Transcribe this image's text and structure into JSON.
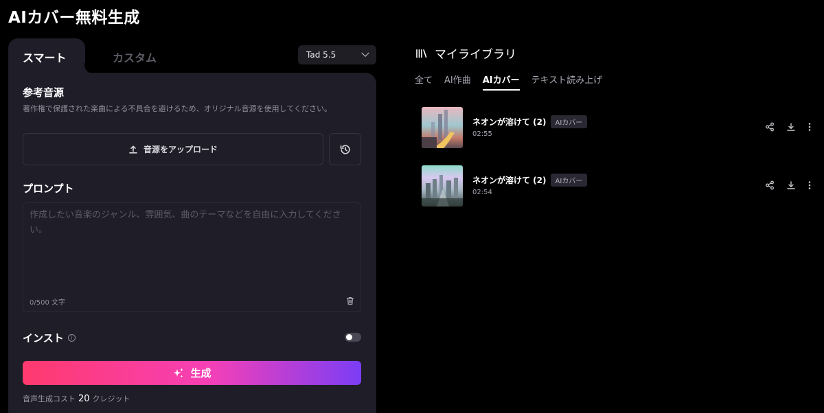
{
  "page": {
    "title": "AIカバー無料生成"
  },
  "left": {
    "tabs": [
      {
        "label": "スマート"
      },
      {
        "label": "カスタム"
      }
    ],
    "model": "Tad 5.5",
    "reference": {
      "title": "参考音源",
      "description": "著作権で保護された楽曲による不具合を避けるため、オリジナル音源を使用してください。",
      "upload_label": "音源をアップロード"
    },
    "prompt": {
      "title": "プロンプト",
      "placeholder": "作成したい音楽のジャンル、雰囲気、曲のテーマなどを自由に入力してください。",
      "count": "0/500 文字"
    },
    "instrumental": {
      "label": "インスト",
      "enabled": false
    },
    "generate_label": "生成",
    "cost": {
      "prefix": "音声生成コスト",
      "amount": "20",
      "suffix": "クレジット"
    }
  },
  "library": {
    "title": "マイライブラリ",
    "tabs": [
      {
        "label": "全て"
      },
      {
        "label": "AI作曲"
      },
      {
        "label": "AIカバー"
      },
      {
        "label": "テキスト読み上げ"
      }
    ],
    "active_tab": "AIカバー",
    "tracks": [
      {
        "name": "ネオンが溶けて (2)",
        "badge": "AIカバー",
        "duration": "02:55"
      },
      {
        "name": "ネオンが溶けて (2)",
        "badge": "AIカバー",
        "duration": "02:54"
      }
    ]
  },
  "colors": {
    "panel_bg": "#1f1d28",
    "generate_gradient": [
      "#ff3a6e",
      "#f640b6",
      "#7b3df5"
    ]
  }
}
